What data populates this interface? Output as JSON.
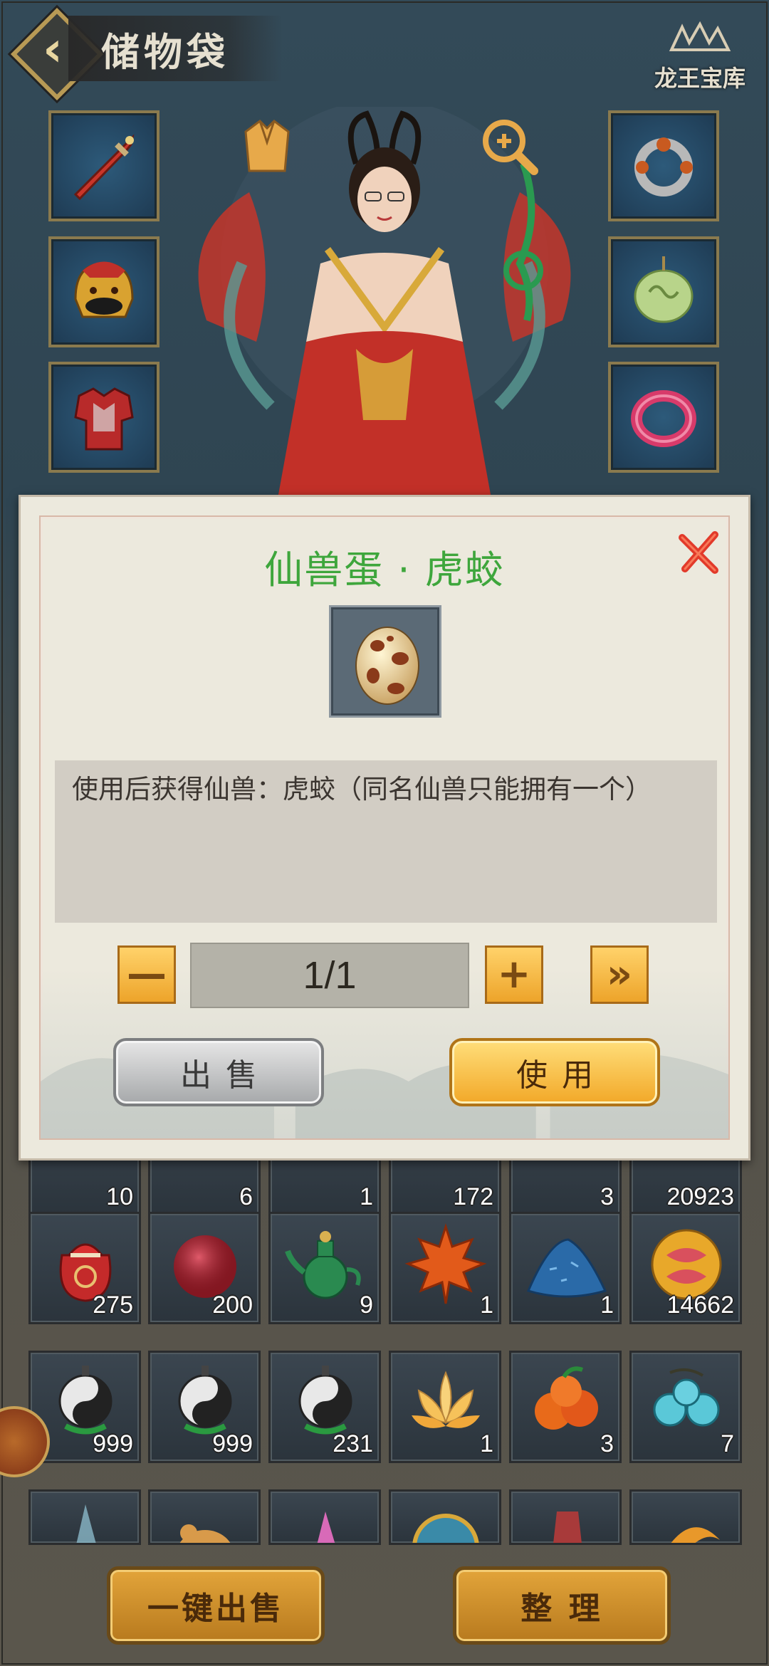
{
  "header": {
    "title": "储物袋",
    "treasure_label": "龙王宝库"
  },
  "equipment": {
    "left": [
      "sword-icon",
      "golden-lion-helmet-icon",
      "red-armor-icon"
    ],
    "right": [
      "ring-icon",
      "jade-pendant-icon",
      "pink-bracelet-icon"
    ],
    "top_icons": [
      "outfit-icon",
      "zoom-in-icon"
    ]
  },
  "bag": {
    "partial_row_counts": [
      "10",
      "6",
      "1",
      "172",
      "3",
      "20923"
    ],
    "rows": [
      [
        {
          "icon": "red-pouch-icon",
          "count": "275"
        },
        {
          "icon": "red-bead-icon",
          "count": "200"
        },
        {
          "icon": "jade-teapot-icon",
          "count": "9"
        },
        {
          "icon": "maple-leaf-icon",
          "count": "1"
        },
        {
          "icon": "blue-sand-pile-icon",
          "count": "1"
        },
        {
          "icon": "golden-orb-icon",
          "count": "14662"
        }
      ],
      [
        {
          "icon": "yin-yang-gourd-icon",
          "count": "999"
        },
        {
          "icon": "yin-yang-gourd-icon",
          "count": "999"
        },
        {
          "icon": "yin-yang-gourd-icon",
          "count": "231"
        },
        {
          "icon": "lotus-icon",
          "count": "1"
        },
        {
          "icon": "orange-fruit-icon",
          "count": "3"
        },
        {
          "icon": "blue-berries-icon",
          "count": "7"
        }
      ]
    ],
    "bottom_buttons": {
      "sell_all": "一键出售",
      "sort": "整 理"
    }
  },
  "dialog": {
    "title": "仙兽蛋 · 虎蛟",
    "item_icon": "spotted-egg-icon",
    "description": "使用后获得仙兽：虎蛟（同名仙兽只能拥有一个）",
    "quantity": "1/1",
    "minus_label": "—",
    "plus_label": "+",
    "max_label": "»",
    "sell_label": "出售",
    "use_label": "使用"
  },
  "colors": {
    "title_green": "#3ea63c",
    "gold_button": "#f2a828",
    "gray_button": "#a6a8aa"
  }
}
